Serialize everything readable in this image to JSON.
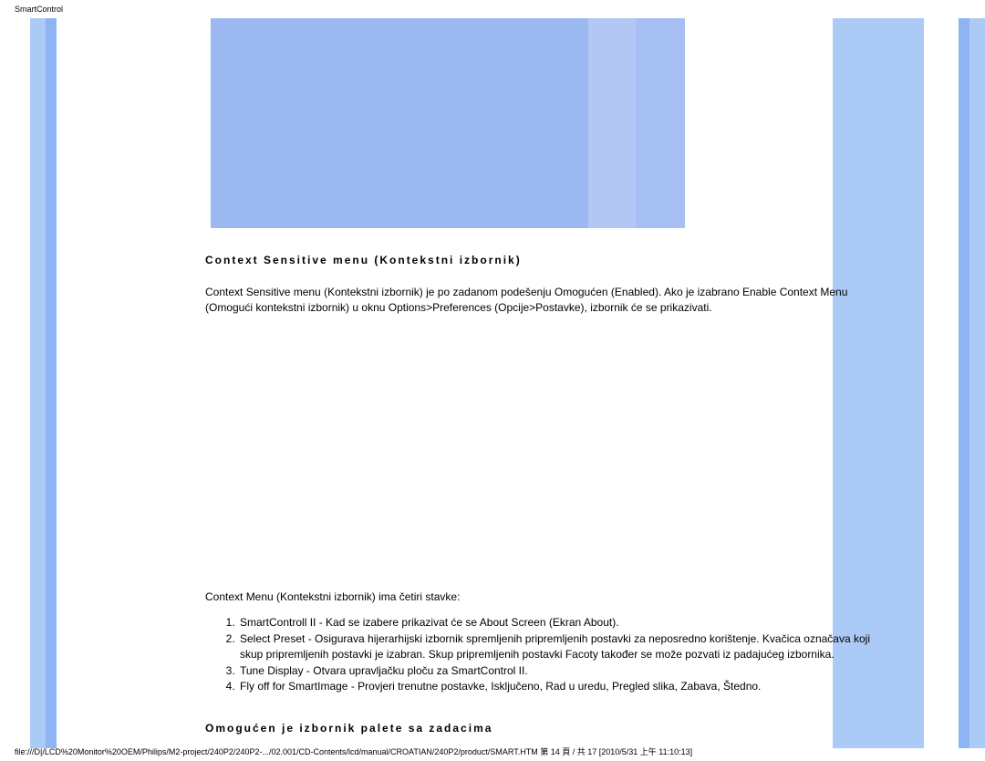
{
  "header": {
    "label": "SmartControl"
  },
  "sections": {
    "context_menu": {
      "title": "Context Sensitive menu (Kontekstni izbornik)",
      "intro": "Context Sensitive menu (Kontekstni izbornik) je po zadanom podešenju Omogućen (Enabled). Ako je izabrano Enable Context Menu (Omogući kontekstni izbornik) u oknu Options>Preferences (Opcije>Postavke), izbornik će se prikazivati.",
      "list_intro": "Context Menu (Kontekstni izbornik) ima četiri stavke:",
      "items": [
        "SmartControll II - Kad se izabere prikazivat će se About Screen (Ekran About).",
        "Select Preset - Osigurava hijerarhijski izbornik spremljenih pripremljenih postavki za neposredno korištenje. Kvačica označava koji skup pripremljenih postavki je izabran. Skup pripremljenih postavki Facoty također se može pozvati iz padajućeg izbornika.",
        "Tune Display - Otvara upravljačku ploču za SmartControl II.",
        "Fly off for SmartImage - Provjeri trenutne postavke, Isključeno, Rad u uredu, Pregled slika, Zabava, Štedno."
      ]
    },
    "task_tray": {
      "title": "Omogućen je izbornik palete sa zadacima"
    }
  },
  "footer": {
    "text": "file:///D|/LCD%20Monitor%20OEM/Philips/M2-project/240P2/240P2-.../02.001/CD-Contents/lcd/manual/CROATIAN/240P2/product/SMART.HTM 第 14 頁 / 共 17 [2010/5/31 上午 11:10:13]"
  }
}
